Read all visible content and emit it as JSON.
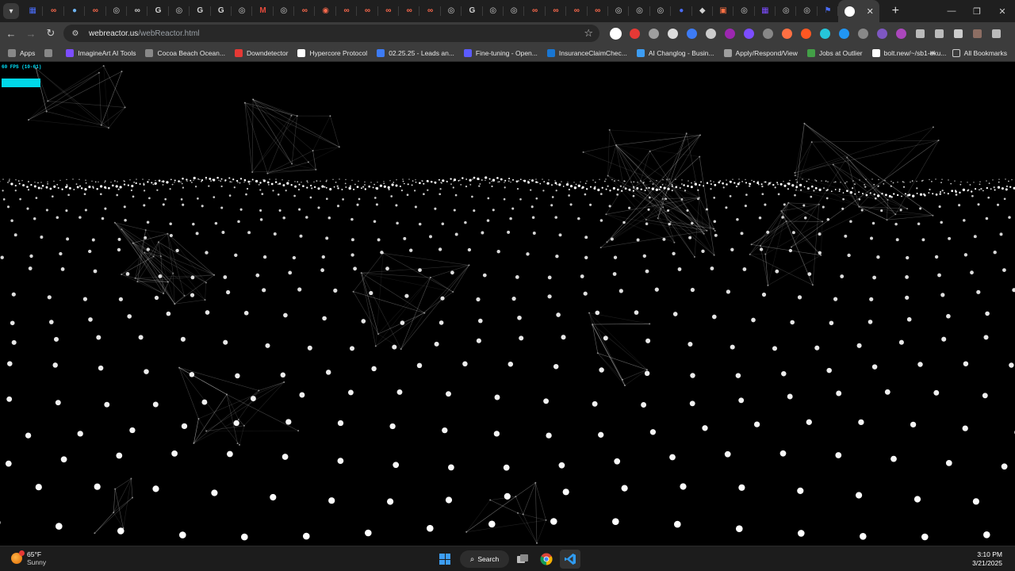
{
  "browser": {
    "tabs": [
      {
        "icon": "chevron-down-icon"
      },
      {
        "icon": "grid-icon",
        "color": "#4a6cf7"
      },
      {
        "icon": "link-icon",
        "color": "#ff6a4d"
      },
      {
        "icon": "globe-icon",
        "color": "#6db3f2"
      },
      {
        "icon": "link-icon",
        "color": "#ff6a4d"
      },
      {
        "icon": "compass-icon",
        "color": "#d0d0d0"
      },
      {
        "icon": "link-icon",
        "color": "#d0d0d0"
      },
      {
        "icon": "google-icon",
        "color": "#d0d0d0"
      },
      {
        "icon": "compass-icon",
        "color": "#d0d0d0"
      },
      {
        "icon": "google-icon",
        "color": "#d0d0d0"
      },
      {
        "icon": "google-icon",
        "color": "#d0d0d0"
      },
      {
        "icon": "compass-icon",
        "color": "#d0d0d0"
      },
      {
        "icon": "gmail-icon",
        "color": "#e64b3c"
      },
      {
        "icon": "compass-icon",
        "color": "#d0d0d0"
      },
      {
        "icon": "link-icon",
        "color": "#ff6a4d"
      },
      {
        "icon": "user-icon",
        "color": "#ff6a4d"
      },
      {
        "icon": "link-icon",
        "color": "#ff6a4d"
      },
      {
        "icon": "link-icon",
        "color": "#ff6a4d"
      },
      {
        "icon": "link-icon",
        "color": "#ff6a4d"
      },
      {
        "icon": "link-icon",
        "color": "#ff6a4d"
      },
      {
        "icon": "link-icon",
        "color": "#ff6a4d"
      },
      {
        "icon": "compass-icon",
        "color": "#d0d0d0"
      },
      {
        "icon": "google-icon",
        "color": "#d0d0d0"
      },
      {
        "icon": "compass-icon",
        "color": "#d0d0d0"
      },
      {
        "icon": "compass-icon",
        "color": "#d0d0d0"
      },
      {
        "icon": "link-icon",
        "color": "#ff6a4d"
      },
      {
        "icon": "link-icon",
        "color": "#ff6a4d"
      },
      {
        "icon": "link-icon",
        "color": "#ff6a4d"
      },
      {
        "icon": "link-icon",
        "color": "#ff6a4d"
      },
      {
        "icon": "compass-icon",
        "color": "#d0d0d0"
      },
      {
        "icon": "compass-icon",
        "color": "#d0d0d0"
      },
      {
        "icon": "compass-icon",
        "color": "#d0d0d0"
      },
      {
        "icon": "globe-icon",
        "color": "#4a6cf7"
      },
      {
        "icon": "diamond-icon",
        "color": "#d0d0d0"
      },
      {
        "icon": "square-icon",
        "color": "#ff7043"
      },
      {
        "icon": "compass-icon",
        "color": "#d0d0d0"
      },
      {
        "icon": "grid-icon",
        "color": "#7c4dff"
      },
      {
        "icon": "compass-icon",
        "color": "#d0d0d0"
      },
      {
        "icon": "compass-icon",
        "color": "#d0d0d0"
      },
      {
        "icon": "flag-icon",
        "color": "#4a6cf7"
      }
    ],
    "active_tab_icon": "chrome-icon",
    "url_host": "webreactor.us",
    "url_path": "/webReactor.html"
  },
  "bookmarks": [
    {
      "label": "Apps",
      "icon": "apps-icon",
      "color": "#888888"
    },
    {
      "label": "",
      "icon": "tab-groups-icon",
      "color": "#888888"
    },
    {
      "label": "ImagineArt AI Tools",
      "icon": "imagineart-icon",
      "color": "#7c4dff"
    },
    {
      "label": "Cocoa Beach Ocean...",
      "icon": "dash-icon",
      "color": "#888888"
    },
    {
      "label": "Downdetector",
      "icon": "alert-icon",
      "color": "#e53935"
    },
    {
      "label": "Hypercore Protocol",
      "icon": "hypercore-icon",
      "color": "#ffffff"
    },
    {
      "label": "02.25.25 - Leads an...",
      "icon": "triangle-icon",
      "color": "#3d7bf5"
    },
    {
      "label": "Fine-tuning - Open...",
      "icon": "openai-icon",
      "color": "#5b5bff"
    },
    {
      "label": "InsuranceClaimChec...",
      "icon": "shield-icon",
      "color": "#1976d2"
    },
    {
      "label": "AI Changlog - Busin...",
      "icon": "ai-icon",
      "color": "#3d9df3"
    },
    {
      "label": "Apply/Respond/View",
      "icon": "apply-icon",
      "color": "#9e9e9e"
    },
    {
      "label": "Jobs at Outlier",
      "icon": "outlier-icon",
      "color": "#43a047"
    },
    {
      "label": "bolt.new/~/sb1-eku...",
      "icon": "bolt-icon",
      "color": "#ffffff"
    }
  ],
  "bookmarks_more": "»",
  "all_bookmarks": "All Bookmarks",
  "scene": {
    "fps_label": "60 FPS (10-61)"
  },
  "taskbar": {
    "temperature": "65°F",
    "condition": "Sunny",
    "search_label": "Search",
    "time": "3:10 PM",
    "date": "3/21/2025"
  },
  "colors": {
    "accent_cyan": "#00d8e8",
    "dot": "#ffffff",
    "windows_blue": "#3d9df3"
  }
}
